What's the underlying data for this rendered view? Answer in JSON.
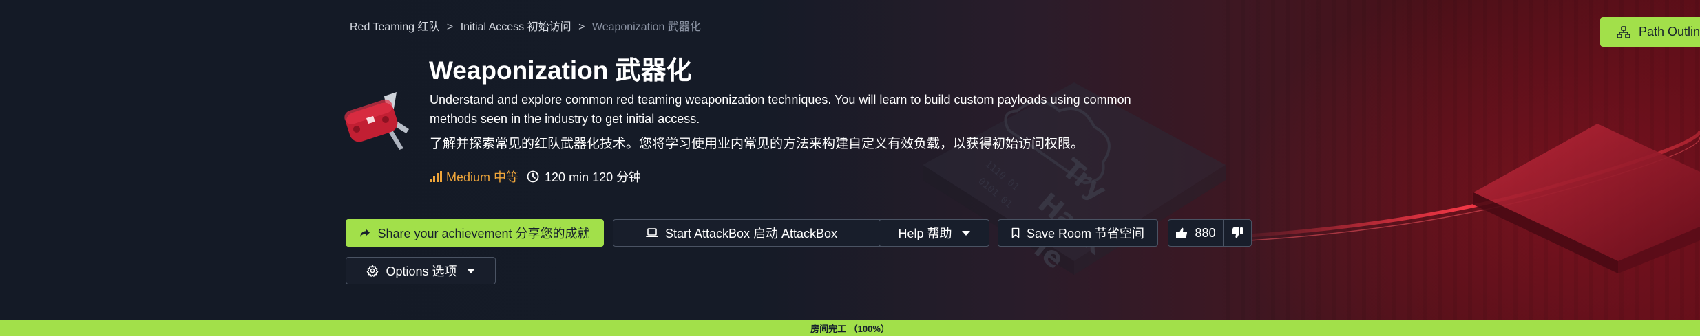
{
  "breadcrumb": {
    "item1": "Red Teaming 红队",
    "sep1": ">",
    "item2": "Initial Access 初始访问",
    "sep2": ">",
    "current": "Weaponization 武器化"
  },
  "room": {
    "title": "Weaponization  武器化",
    "description": "Understand and explore common red teaming weaponization techniques. You will learn to build custom payloads using common methods seen in the industry to get initial access.",
    "description_zh": "了解并探索常见的红队武器化技术。您将学习使用业内常见的方法来构建自定义有效负载，以获得初始访问权限。",
    "difficulty": "Medium 中等",
    "duration": "120 min 120 分钟",
    "icon": "swiss-army-knife-icon"
  },
  "actions": {
    "share_label": "Share your achievement  分享您的成就",
    "attackbox_label": "Start AttackBox  启动 AttackBox",
    "help_label": "Help  帮助",
    "save_label": "Save Room  节省空间",
    "likes_count": "880",
    "options_label": "Options  选项"
  },
  "path_outline": {
    "label": "Path Outline"
  },
  "progress": {
    "label": "房间完工 （100%）",
    "value_percent": 100
  },
  "colors": {
    "accent_green": "#a2e04a",
    "difficulty_orange": "#f0a63a",
    "background_dark": "#151b27",
    "background_red": "#5a0e18"
  }
}
